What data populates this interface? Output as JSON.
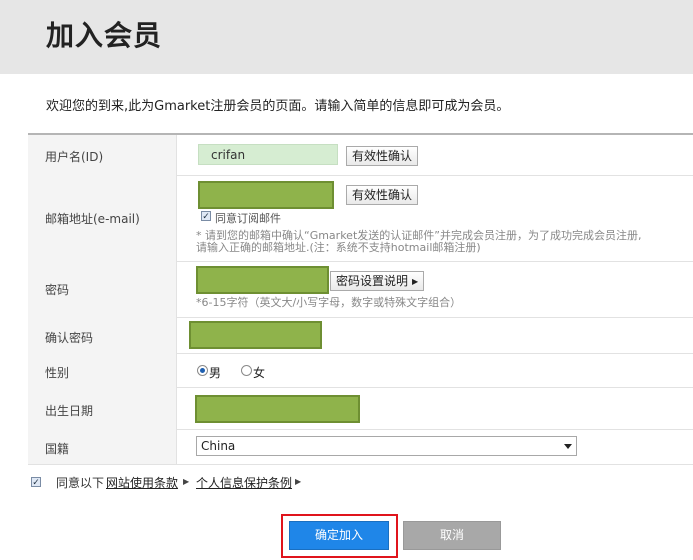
{
  "header": {
    "title": "加入会员"
  },
  "welcome_text": "欢迎您的到来,此为Gmarket注册会员的页面。请输入简单的信息即可成为会员。",
  "form": {
    "username": {
      "label": "用户名(ID)",
      "value": "crifan",
      "check_button": "有效性确认"
    },
    "email": {
      "label": "邮箱地址(e-mail)",
      "check_button": "有效性确认",
      "subscribe_label": "同意订阅邮件",
      "subscribe_checked": true,
      "hint_line1": "* 请到您的邮箱中确认“Gmarket发送的认证邮件”并完成会员注册，为了成功完成会员注册,",
      "hint_line2": "请输入正确的邮箱地址.(注：系统不支持hotmail邮箱注册)"
    },
    "password": {
      "label": "密码",
      "help_button": "密码设置说明",
      "hint": "*6-15字符（英文大/小写字母，数字或特殊文字组合）"
    },
    "confirm_password": {
      "label": "确认密码"
    },
    "gender": {
      "label": "性别",
      "options": [
        "男",
        "女"
      ],
      "selected": "男"
    },
    "birthdate": {
      "label": "出生日期"
    },
    "nationality": {
      "label": "国籍",
      "value": "China"
    }
  },
  "agreement": {
    "checked": true,
    "prefix": "同意以下",
    "terms_link": "网站使用条款",
    "privacy_link": "个人信息保护条例"
  },
  "buttons": {
    "confirm": "确定加入",
    "cancel": "取消"
  },
  "colors": {
    "confirm_blue": "#1f86e8",
    "highlight_red": "#e0141c",
    "redaction_green": "#8fb34b"
  }
}
